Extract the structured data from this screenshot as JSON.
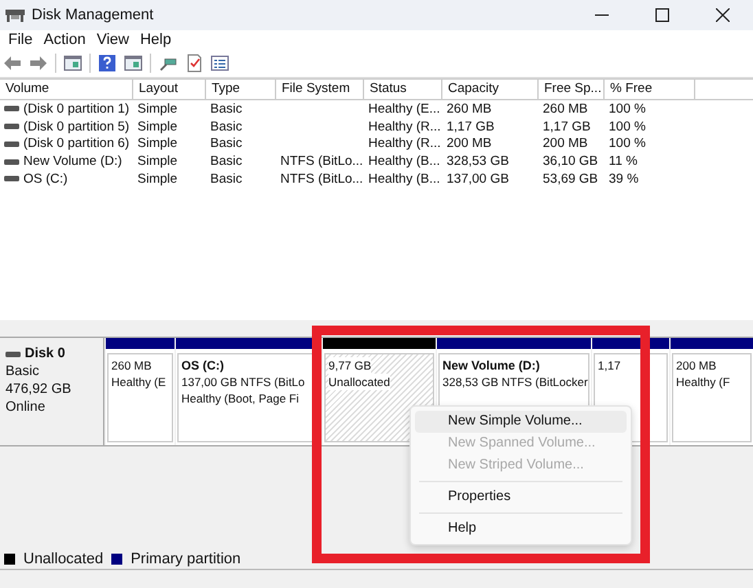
{
  "window": {
    "title": "Disk Management"
  },
  "menu_bar": [
    "File",
    "Action",
    "View",
    "Help"
  ],
  "table": {
    "columns": [
      "Volume",
      "Layout",
      "Type",
      "File System",
      "Status",
      "Capacity",
      "Free Sp...",
      "% Free"
    ],
    "rows": [
      [
        "(Disk 0 partition 1)",
        "Simple",
        "Basic",
        "",
        "Healthy (E...",
        "260 MB",
        "260 MB",
        "100 %"
      ],
      [
        "(Disk 0 partition 5)",
        "Simple",
        "Basic",
        "",
        "Healthy (R...",
        "1,17 GB",
        "1,17 GB",
        "100 %"
      ],
      [
        "(Disk 0 partition 6)",
        "Simple",
        "Basic",
        "",
        "Healthy (R...",
        "200 MB",
        "200 MB",
        "100 %"
      ],
      [
        "New Volume (D:)",
        "Simple",
        "Basic",
        "NTFS (BitLo...",
        "Healthy (B...",
        "328,53 GB",
        "36,10 GB",
        "11 %"
      ],
      [
        "OS (C:)",
        "Simple",
        "Basic",
        "NTFS (BitLo...",
        "Healthy (B...",
        "137,00 GB",
        "53,69 GB",
        "39 %"
      ]
    ]
  },
  "disk": {
    "name": "Disk 0",
    "type": "Basic",
    "size": "476,92 GB",
    "status": "Online",
    "partitions": [
      {
        "kind": "primary",
        "lines": [
          "260 MB",
          "Healthy (E"
        ]
      },
      {
        "kind": "primary",
        "title": "OS  (C:)",
        "lines": [
          "137,00 GB NTFS (BitLo",
          "Healthy (Boot, Page Fi"
        ]
      },
      {
        "kind": "unallocated",
        "lines": [
          "9,77 GB",
          "Unallocated"
        ]
      },
      {
        "kind": "primary",
        "title": "New Volume  (D:)",
        "lines": [
          "328,53 GB NTFS (BitLocker"
        ]
      },
      {
        "kind": "primary",
        "lines": [
          "1,17"
        ]
      },
      {
        "kind": "primary",
        "lines": [
          "200 MB",
          "Healthy (F"
        ]
      }
    ]
  },
  "legend": [
    {
      "label": "Unallocated",
      "color": "#000000"
    },
    {
      "label": "Primary partition",
      "color": "#000080"
    }
  ],
  "context_menu": [
    {
      "kind": "item",
      "label": "New Simple Volume...",
      "disabled": false,
      "selected": true
    },
    {
      "kind": "item",
      "label": "New Spanned Volume...",
      "disabled": true,
      "selected": false
    },
    {
      "kind": "item",
      "label": "New Striped Volume...",
      "disabled": true,
      "selected": false
    },
    {
      "kind": "separator"
    },
    {
      "kind": "item",
      "label": "Properties",
      "disabled": false,
      "selected": false
    },
    {
      "kind": "separator"
    },
    {
      "kind": "item",
      "label": "Help",
      "disabled": false,
      "selected": false
    }
  ]
}
